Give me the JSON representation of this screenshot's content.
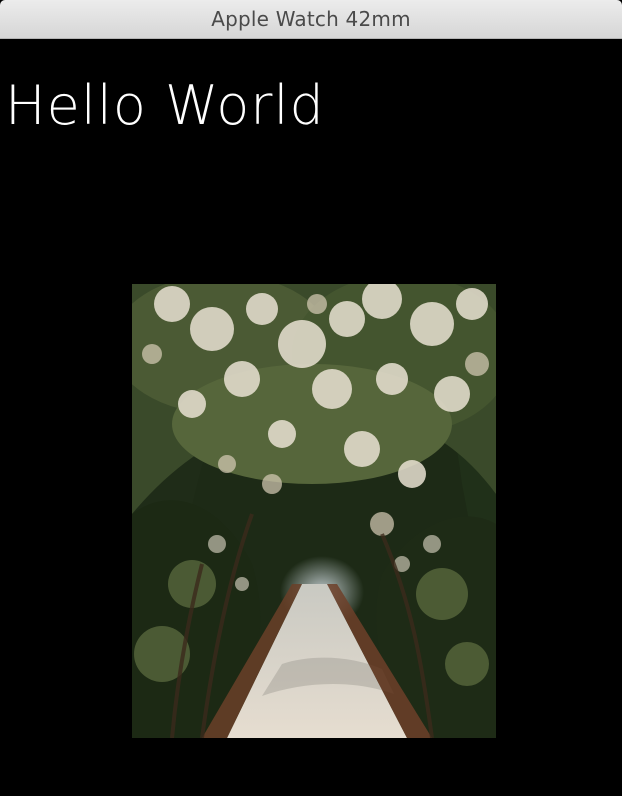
{
  "window": {
    "title": "Apple Watch 42mm"
  },
  "screen": {
    "label_text": "Hello World",
    "image_icon": "photo-of-tree-covered-walkway"
  }
}
